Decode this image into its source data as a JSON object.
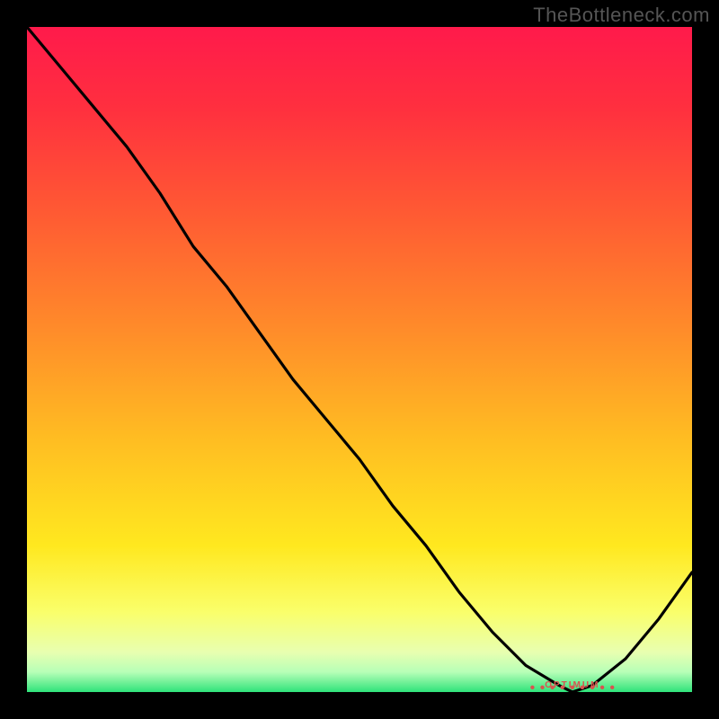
{
  "watermark": "TheBottleneck.com",
  "chart_data": {
    "type": "line",
    "title": "",
    "xlabel": "",
    "ylabel": "",
    "xlim": [
      0,
      100
    ],
    "ylim": [
      0,
      100
    ],
    "x": [
      0,
      5,
      10,
      15,
      20,
      25,
      30,
      35,
      40,
      45,
      50,
      55,
      60,
      65,
      70,
      75,
      80,
      82,
      85,
      90,
      95,
      100
    ],
    "y": [
      100,
      94,
      88,
      82,
      75,
      67,
      61,
      54,
      47,
      41,
      35,
      28,
      22,
      15,
      9,
      4,
      1,
      0,
      1,
      5,
      11,
      18
    ],
    "background_gradient": {
      "stops": [
        {
          "pos": 0.0,
          "color": "#ff1a4b"
        },
        {
          "pos": 0.12,
          "color": "#ff2f3f"
        },
        {
          "pos": 0.28,
          "color": "#ff5a33"
        },
        {
          "pos": 0.45,
          "color": "#ff8a2a"
        },
        {
          "pos": 0.62,
          "color": "#ffbd22"
        },
        {
          "pos": 0.78,
          "color": "#ffe81f"
        },
        {
          "pos": 0.88,
          "color": "#faff6b"
        },
        {
          "pos": 0.94,
          "color": "#e8ffb0"
        },
        {
          "pos": 0.97,
          "color": "#b7ffb7"
        },
        {
          "pos": 1.0,
          "color": "#2fe37a"
        }
      ]
    },
    "marker": {
      "x_start": 76,
      "x_end": 88,
      "y": 0.7,
      "label": "OPTIMUM",
      "color": "#d9534f"
    }
  }
}
